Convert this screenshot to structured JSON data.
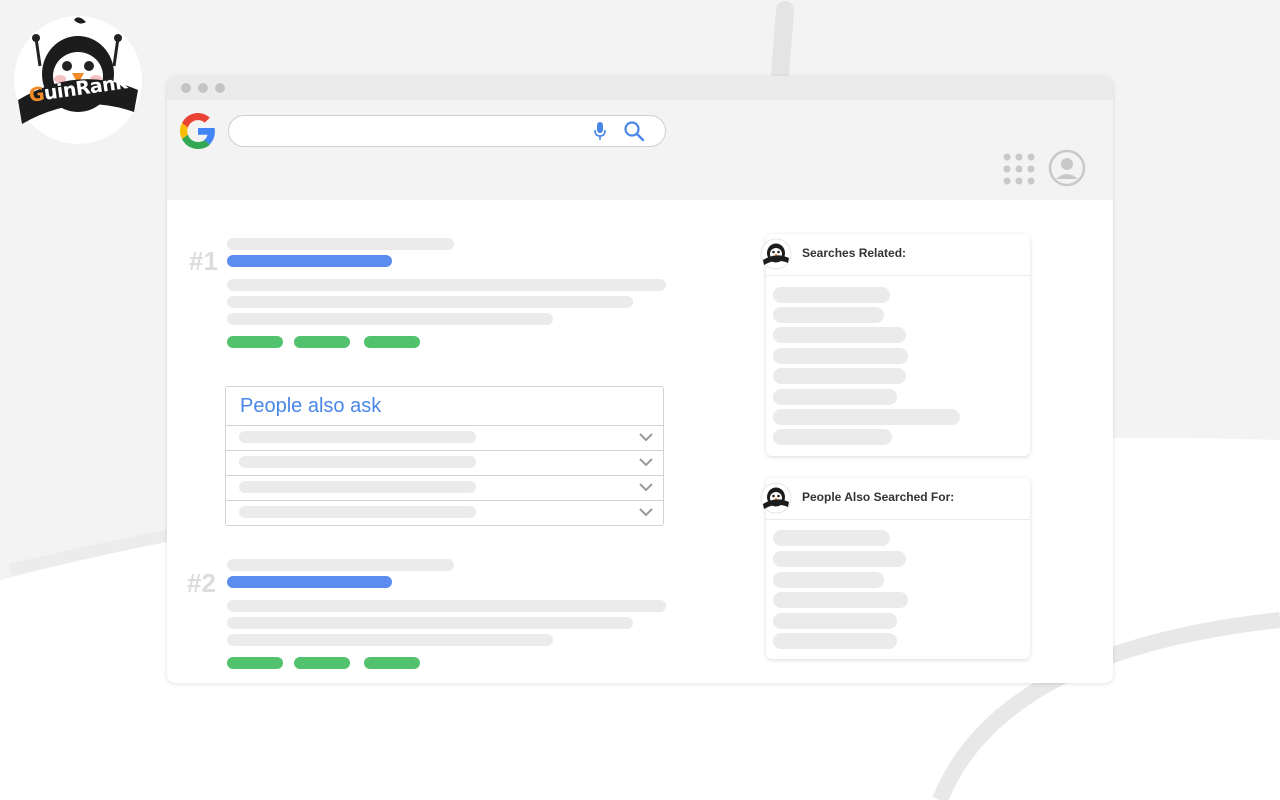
{
  "brand": {
    "name": "GuinRank",
    "logo_icon": "penguin-logo"
  },
  "browser": {
    "window_controls": [
      "window-dot",
      "window-dot",
      "window-dot"
    ],
    "search_placeholder": "",
    "search_engine_icon": "google-g-icon"
  },
  "results": {
    "first_rank": "#1",
    "second_rank": "#2"
  },
  "people_also_ask": {
    "title": "People also ask",
    "questions": [
      "",
      "",
      "",
      ""
    ]
  },
  "sidebar": {
    "searches_related_title": "Searches Related:",
    "people_also_searched_title": "People Also Searched For:"
  },
  "colors": {
    "accent_blue": "#4a86e8",
    "link_blue": "#5b8def",
    "url_green": "#52c26e",
    "placeholder_gray": "#ebebeb"
  }
}
